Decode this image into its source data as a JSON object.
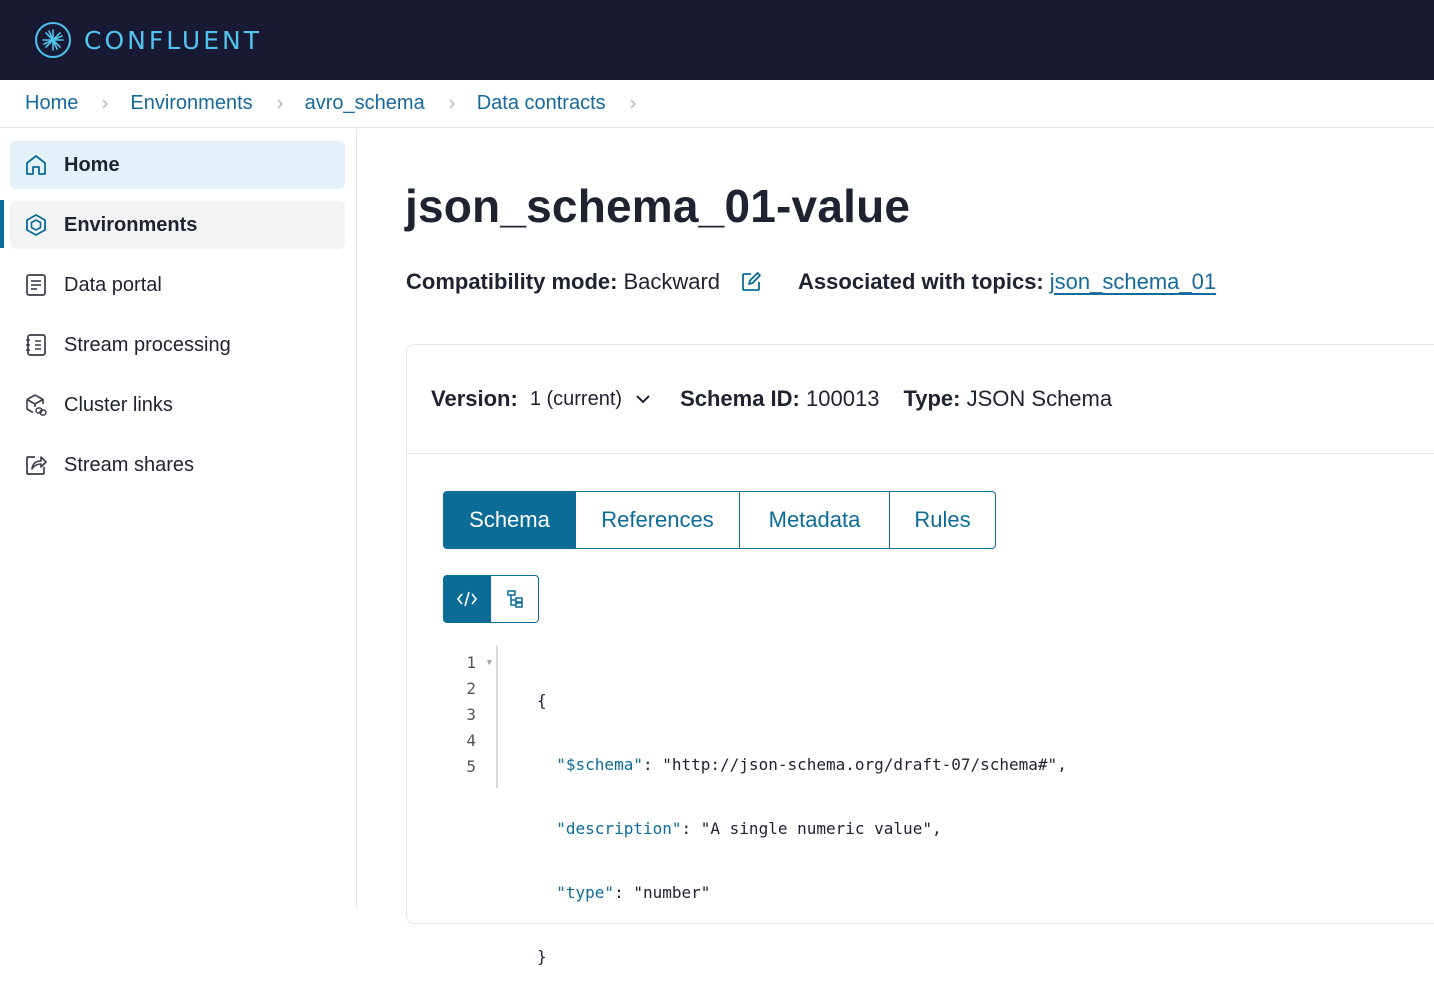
{
  "brand": {
    "name": "CONFLUENT"
  },
  "breadcrumb": [
    "Home",
    "Environments",
    "avro_schema",
    "Data contracts"
  ],
  "sidebar": {
    "items": [
      {
        "label": "Home",
        "icon": "home-icon"
      },
      {
        "label": "Environments",
        "icon": "cube-icon"
      },
      {
        "label": "Data portal",
        "icon": "document-icon"
      },
      {
        "label": "Stream processing",
        "icon": "notebook-icon"
      },
      {
        "label": "Cluster links",
        "icon": "link-cube-icon"
      },
      {
        "label": "Stream shares",
        "icon": "share-icon"
      }
    ]
  },
  "page": {
    "title": "json_schema_01-value",
    "compat_label": "Compatibility mode:",
    "compat_value": "Backward",
    "topics_label": "Associated with topics:",
    "topics_value": "json_schema_01"
  },
  "schema_info": {
    "version_label": "Version:",
    "version_value": "1 (current)",
    "id_label": "Schema ID:",
    "id_value": "100013",
    "type_label": "Type:",
    "type_value": "JSON Schema"
  },
  "tabs": [
    "Schema",
    "References",
    "Metadata",
    "Rules"
  ],
  "view_toggle": [
    "code-view-icon",
    "tree-view-icon"
  ],
  "code": {
    "line_numbers": [
      "1",
      "2",
      "3",
      "4",
      "5"
    ],
    "open_brace": "{",
    "close_brace": "}",
    "entries": [
      {
        "key": "\"$schema\"",
        "value": "\"http://json-schema.org/draft-07/schema#\"",
        "trail": ","
      },
      {
        "key": "\"description\"",
        "value": "\"A single numeric value\"",
        "trail": ","
      },
      {
        "key": "\"type\"",
        "value": "\"number\"",
        "trail": ""
      }
    ]
  },
  "colors": {
    "topbar": "#181a33",
    "accent": "#0a6c97",
    "link": "#16699b",
    "brand_text": "#51c3ee"
  }
}
